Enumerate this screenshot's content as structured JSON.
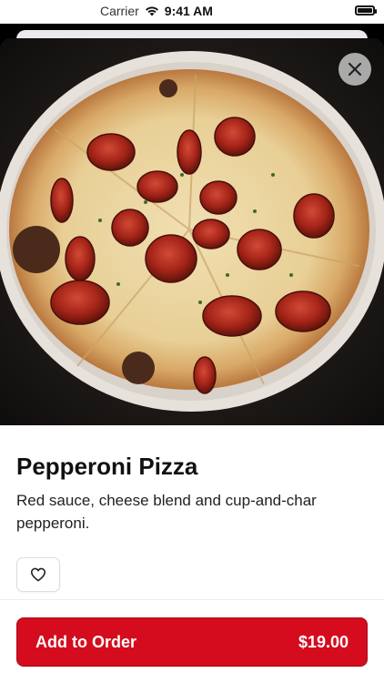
{
  "status_bar": {
    "carrier": "Carrier",
    "time": "9:41 AM"
  },
  "icons": {
    "wifi": "wifi-icon",
    "battery": "battery-icon",
    "close": "close-icon",
    "favorite": "heart-outline-icon"
  },
  "product": {
    "name": "Pepperoni Pizza",
    "description": "Red sauce, cheese blend and cup-and-char pepperoni.",
    "image_alt": "Pepperoni pizza on a plate"
  },
  "actions": {
    "add_label": "Add to Order",
    "price": "$19.00"
  },
  "colors": {
    "accent": "#d40c1e",
    "text": "#111111"
  }
}
